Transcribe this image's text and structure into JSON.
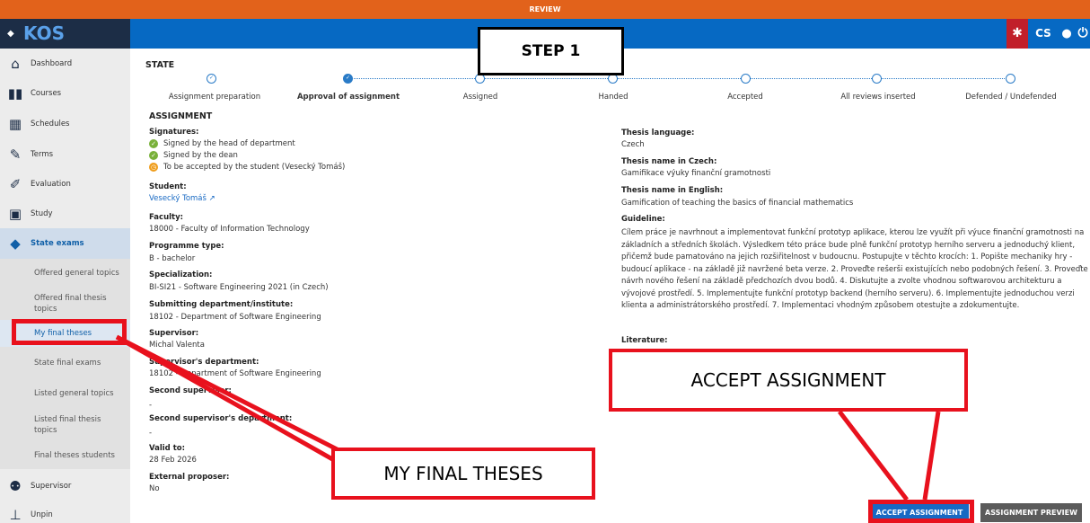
{
  "review_banner": "REVIEW",
  "brand": {
    "logo_text": "KOS"
  },
  "topbar": {
    "lang": "CS"
  },
  "sidebar": {
    "items": [
      {
        "label": "Dashboard",
        "icon": "home-icon"
      },
      {
        "label": "Courses",
        "icon": "book-icon"
      },
      {
        "label": "Schedules",
        "icon": "calendar-icon"
      },
      {
        "label": "Terms",
        "icon": "edit-icon"
      },
      {
        "label": "Evaluation",
        "icon": "pencil-icon"
      },
      {
        "label": "Study",
        "icon": "id-card-icon"
      },
      {
        "label": "State exams",
        "icon": "graduation-cap-icon"
      }
    ],
    "sub_items": [
      "Offered general topics",
      "Offered final thesis topics",
      "My final theses",
      "State final exams",
      "Listed general topics",
      "Listed final thesis topics",
      "Final theses students"
    ],
    "bottom_items": [
      {
        "label": "Supervisor",
        "icon": "users-icon"
      },
      {
        "label": "Unpin",
        "icon": "pin-icon"
      }
    ]
  },
  "state": {
    "title": "STATE",
    "steps": [
      "Assignment preparation",
      "Approval of assignment",
      "Assigned",
      "Handed",
      "Accepted",
      "All reviews inserted",
      "Defended / Undefended"
    ],
    "current_step": "Approval of assignment"
  },
  "assignment": {
    "title": "ASSIGNMENT",
    "signatures_label": "Signatures:",
    "signatures": [
      {
        "text": "Signed by the head of department",
        "status": "done"
      },
      {
        "text": "Signed by the dean",
        "status": "done"
      },
      {
        "text": "To be accepted by the student (Vesecký Tomáš)",
        "status": "pending"
      }
    ],
    "student_label": "Student:",
    "student": "Vesecký Tomáš",
    "faculty_label": "Faculty:",
    "faculty": "18000 - Faculty of Information Technology",
    "programme_label": "Programme type:",
    "programme": "B - bachelor",
    "specialization_label": "Specialization:",
    "specialization": "BI-SI21 - Software Engineering 2021 (in Czech)",
    "department_label": "Submitting department/institute:",
    "department": "18102 - Department of Software Engineering",
    "supervisor_label": "Supervisor:",
    "supervisor": "Michal Valenta",
    "supervisor_dept_label": "Supervisor's department:",
    "supervisor_dept": "18102 - Department of Software Engineering",
    "second_supervisor_label": "Second supervisor:",
    "second_supervisor": "-",
    "second_supervisor_dept_label": "Second supervisor's department:",
    "second_supervisor_dept": "-",
    "valid_to_label": "Valid to:",
    "valid_to": "28 Feb 2026",
    "external_label": "External proposer:",
    "external": "No",
    "language_label": "Thesis language:",
    "language": "Czech",
    "name_cz_label": "Thesis name in Czech:",
    "name_cz": "Gamifikace výuky finanční gramotnosti",
    "name_en_label": "Thesis name in English:",
    "name_en": "Gamification of teaching the basics of financial mathematics",
    "guideline_label": "Guideline:",
    "guideline": "Cílem práce je navrhnout a implementovat funkční prototyp aplikace, kterou lze využít při výuce finanční gramotnosti na základních a středních školách. Výsledkem této práce bude plně funkční prototyp herního serveru a jednoduchý klient, přičemž bude pamatováno na jejich rozšiřitelnost v budoucnu. Postupujte v těchto krocích: 1. Popište mechaniky hry - budoucí aplikace - na základě již navržené beta verze. 2. Proveďte rešerši existujících nebo podobných řešení. 3. Proveďte návrh nového řešení na základě předchozích dvou bodů. 4. Diskutujte a zvolte vhodnou softwarovou architekturu a vývojové prostředí. 5. Implementujte funkční prototyp backend (herního serveru). 6. Implementujte jednoduchou verzi klienta a administrátorského prostředí. 7. Implementaci vhodným způsobem otestujte a zdokumentujte.",
    "literature_label": "Literature:"
  },
  "buttons": {
    "accept": "ACCEPT ASSIGNMENT",
    "preview": "ASSIGNMENT PREVIEW"
  },
  "annotations": {
    "step": "STEP 1",
    "accept_callout": "ACCEPT ASSIGNMENT",
    "theses_callout": "MY FINAL THESES"
  }
}
